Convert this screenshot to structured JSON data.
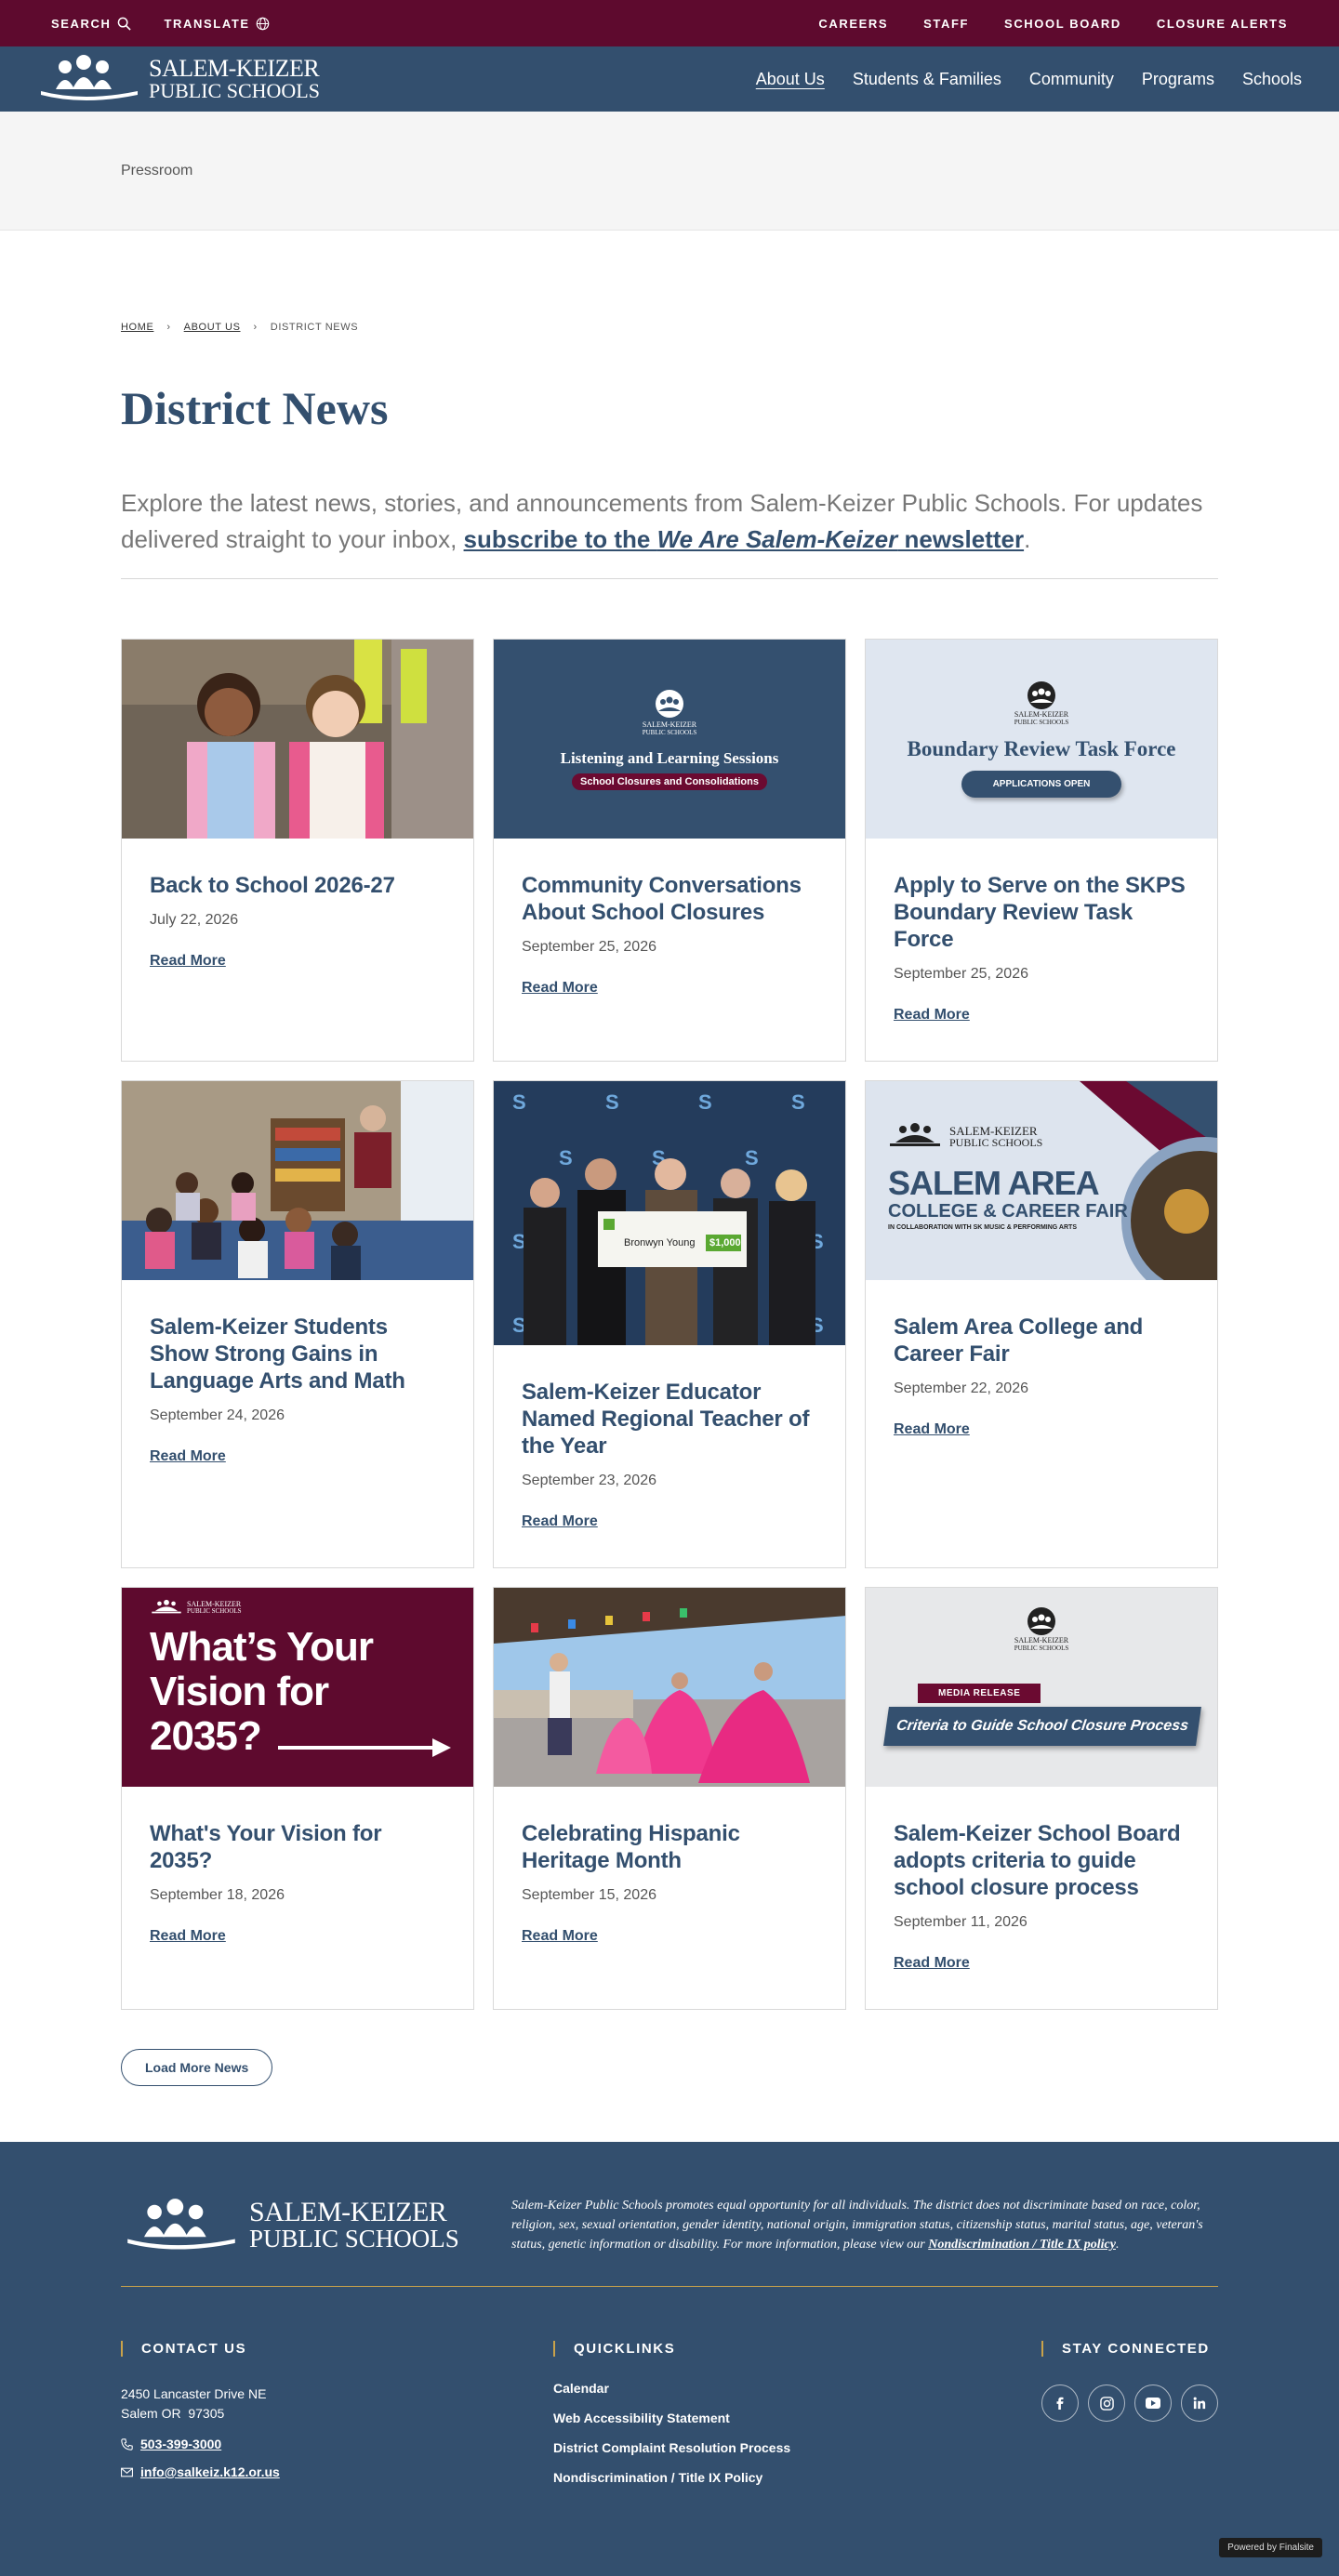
{
  "utility": {
    "search": "SEARCH",
    "translate": "TRANSLATE",
    "links": [
      "CAREERS",
      "STAFF",
      "SCHOOL BOARD",
      "CLOSURE ALERTS"
    ]
  },
  "logo": {
    "line1": "SALEM-KEIZER",
    "line2": "PUBLIC SCHOOLS"
  },
  "nav": [
    "About Us",
    "Students & Families",
    "Community",
    "Programs",
    "Schools"
  ],
  "section": "Pressroom",
  "breadcrumb": {
    "home": "HOME",
    "about": "ABOUT US",
    "current": "DISTRICT NEWS",
    "separator": "›"
  },
  "page_title": "District News",
  "intro": {
    "text": "Explore the latest news, stories, and announcements from Salem-Keizer Public Schools. For updates delivered straight to your inbox, ",
    "link_pre": "subscribe to the ",
    "link_em": "We Are Salem-Keizer",
    "link_post": " newsletter",
    "end": "."
  },
  "read_more": "Read More",
  "cards": [
    {
      "title": "Back to School 2026-27",
      "date": "July 22, 2026"
    },
    {
      "title": "Community Conversations About School Closures",
      "date": "September 25, 2026",
      "image": {
        "title": "Listening and Learning Sessions",
        "tag": "School Closures and Consolidations",
        "logo1": "SALEM-KEIZER",
        "logo2": "PUBLIC SCHOOLS"
      }
    },
    {
      "title": "Apply to Serve on the SKPS Boundary Review Task Force",
      "date": "September 25, 2026",
      "image": {
        "title": "Boundary Review Task Force",
        "button": "APPLICATIONS OPEN",
        "logo1": "SALEM-KEIZER",
        "logo2": "PUBLIC SCHOOLS"
      }
    },
    {
      "title": "Salem-Keizer Students Show Strong Gains in Language Arts and Math",
      "date": "September 24, 2026"
    },
    {
      "title": "Salem-Keizer Educator Named Regional Teacher of the Year",
      "date": "September 23, 2026",
      "image": {
        "check_name": "Bronwyn Young",
        "check_amount": "$1,000"
      }
    },
    {
      "title": "Salem Area College and Career Fair",
      "date": "September 22, 2026",
      "image": {
        "logo1": "SALEM-KEIZER",
        "logo2": "PUBLIC SCHOOLS",
        "line1": "SALEM AREA",
        "line2": "COLLEGE & CAREER FAIR",
        "line3": "IN COLLABORATION WITH SK MUSIC & PERFORMING ARTS"
      }
    },
    {
      "title": "What's Your Vision for 2035?",
      "date": "September 18, 2026",
      "image": {
        "logo1": "SALEM-KEIZER",
        "logo2": "PUBLIC SCHOOLS",
        "line1": "What’s Your",
        "line2": "Vision for",
        "line3": "2035?"
      }
    },
    {
      "title": "Celebrating Hispanic Heritage Month",
      "date": "September 15, 2026"
    },
    {
      "title": "Salem-Keizer School Board adopts criteria to guide school closure process",
      "date": "September 11, 2026",
      "image": {
        "tag": "MEDIA RELEASE",
        "banner": "Criteria to Guide School Closure Process",
        "logo1": "SALEM-KEIZER",
        "logo2": "PUBLIC SCHOOLS"
      }
    }
  ],
  "load_more": "Load More News",
  "footer": {
    "statement": "Salem-Keizer Public Schools promotes equal opportunity for all individuals. The district does not discriminate based on race, color, religion, sex, sexual orientation, gender identity, national origin, immigration status, citizenship status, marital status, age, veteran's status, genetic information or disability. For more information, please view our ",
    "statement_link": "Nondiscrimination / Title IX policy",
    "statement_end": ".",
    "contact_head": "CONTACT US",
    "address1": "2450 Lancaster Drive NE",
    "address2": "Salem OR  97305",
    "phone": "503-399-3000",
    "email": "info@salkeiz.k12.or.us",
    "quick_head": "QUICKLINKS",
    "quicklinks": [
      "Calendar",
      "Web Accessibility Statement",
      "District Complaint Resolution Process",
      "Nondiscrimination / Title IX Policy"
    ],
    "social_head": "STAY CONNECTED",
    "powered": "Powered by Finalsite"
  },
  "colors": {
    "burgundy": "#5e0a2e",
    "navy": "#334f6e",
    "gold": "#c9a24a"
  }
}
